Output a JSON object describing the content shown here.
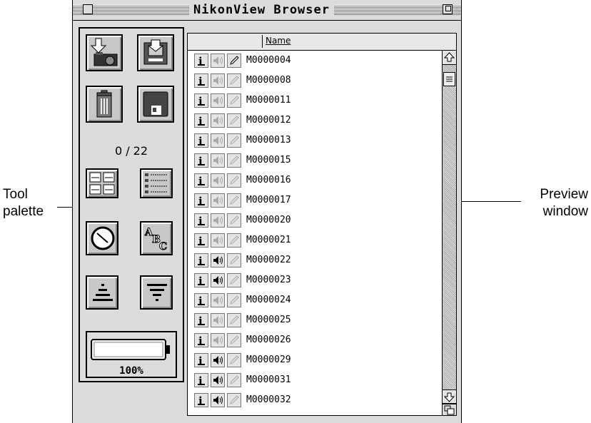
{
  "window": {
    "title": "NikonView Browser"
  },
  "callouts": {
    "tool_palette": "Tool\npalette",
    "preview_window": "Preview\nwindow"
  },
  "palette": {
    "counter": "0 / 22",
    "battery_level": "100%",
    "tools": [
      "download-from-camera",
      "save-to-floppy",
      "delete-trash",
      "save-disk",
      "view-icons",
      "view-list",
      "sort-by-date",
      "sort-by-name",
      "sort-ascending",
      "sort-descending"
    ]
  },
  "preview": {
    "column_header": "Name",
    "items": [
      {
        "name": "M0000004",
        "has_sound": false,
        "has_note": true
      },
      {
        "name": "M0000008",
        "has_sound": false,
        "has_note": false
      },
      {
        "name": "M0000011",
        "has_sound": false,
        "has_note": false
      },
      {
        "name": "M0000012",
        "has_sound": false,
        "has_note": false
      },
      {
        "name": "M0000013",
        "has_sound": false,
        "has_note": false
      },
      {
        "name": "M0000015",
        "has_sound": false,
        "has_note": false
      },
      {
        "name": "M0000016",
        "has_sound": false,
        "has_note": false
      },
      {
        "name": "M0000017",
        "has_sound": false,
        "has_note": false
      },
      {
        "name": "M0000020",
        "has_sound": false,
        "has_note": false
      },
      {
        "name": "M0000021",
        "has_sound": false,
        "has_note": false
      },
      {
        "name": "M0000022",
        "has_sound": true,
        "has_note": false
      },
      {
        "name": "M0000023",
        "has_sound": true,
        "has_note": false
      },
      {
        "name": "M0000024",
        "has_sound": false,
        "has_note": false
      },
      {
        "name": "M0000025",
        "has_sound": false,
        "has_note": false
      },
      {
        "name": "M0000026",
        "has_sound": false,
        "has_note": false
      },
      {
        "name": "M0000029",
        "has_sound": true,
        "has_note": false
      },
      {
        "name": "M0000031",
        "has_sound": true,
        "has_note": false
      },
      {
        "name": "M0000032",
        "has_sound": true,
        "has_note": false
      }
    ]
  }
}
